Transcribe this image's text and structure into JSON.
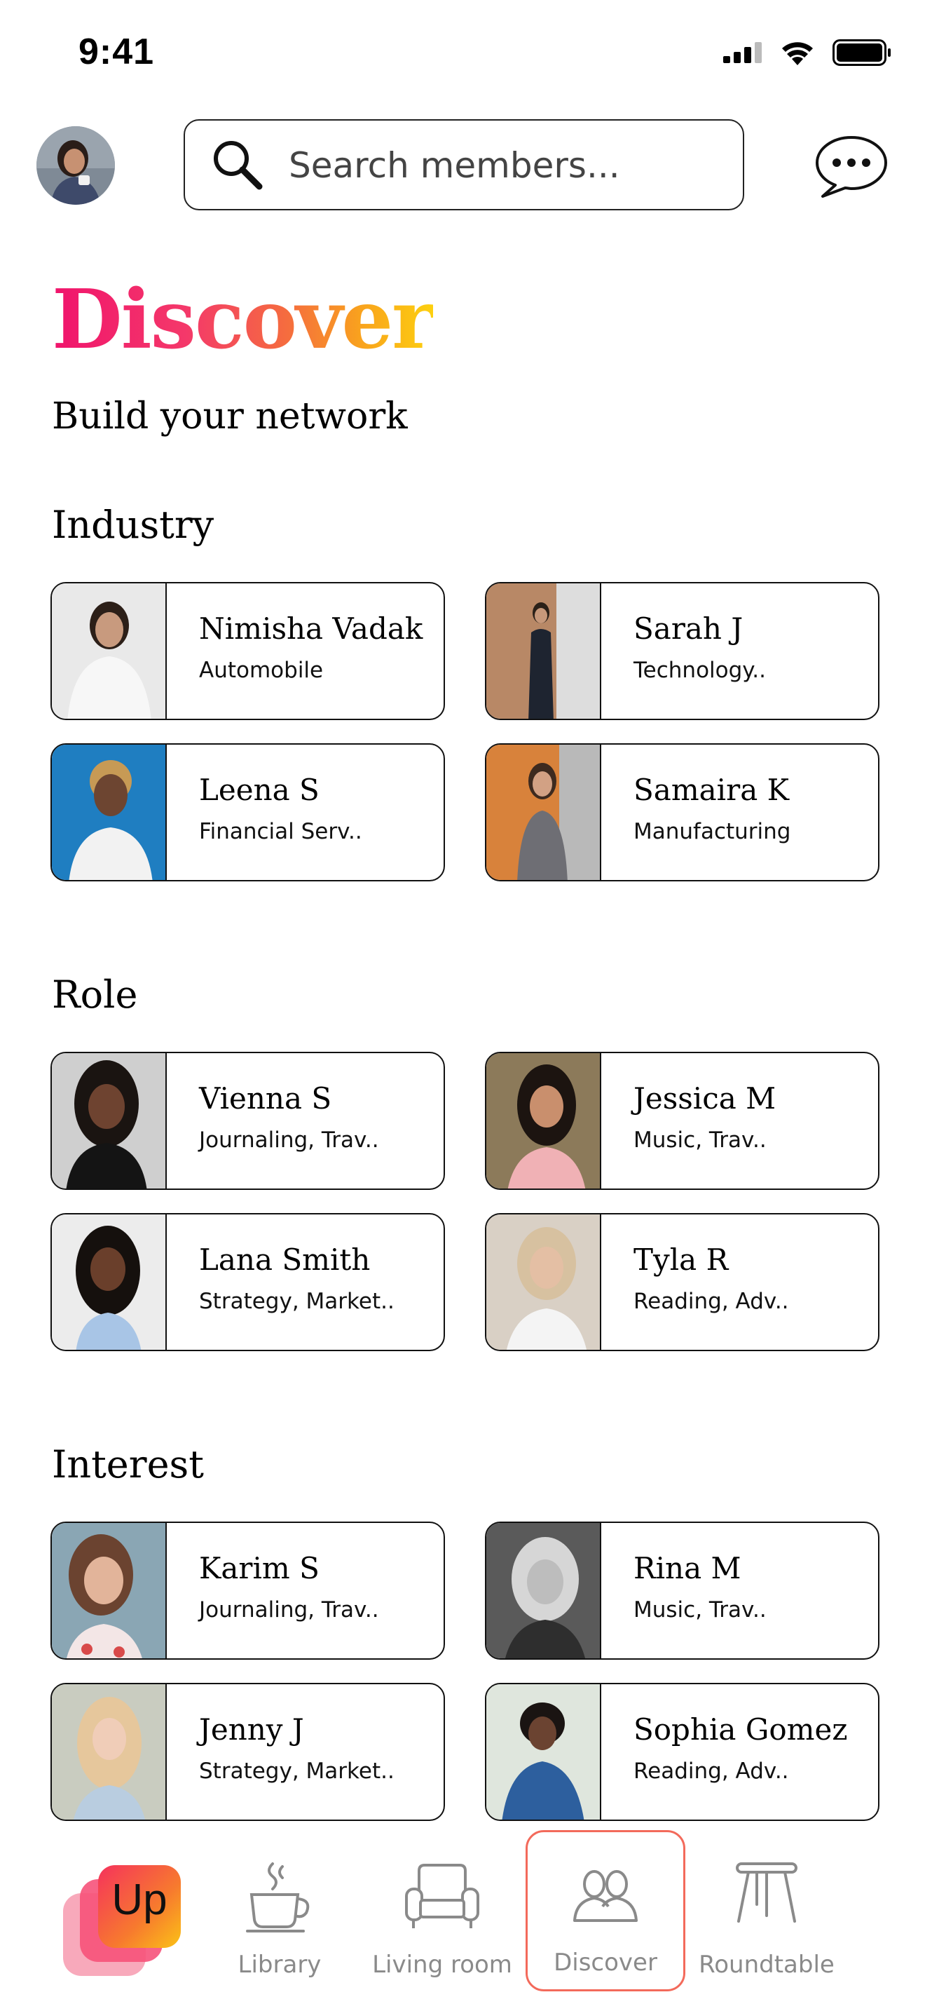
{
  "status_bar": {
    "time": "9:41"
  },
  "search": {
    "placeholder": "Search members..."
  },
  "page": {
    "title": "Discover",
    "subtitle": "Build your network"
  },
  "sections": [
    {
      "title": "Industry",
      "members": [
        {
          "name": "Nimisha Vadak",
          "tag": "Automobile"
        },
        {
          "name": "Sarah J",
          "tag": " Technology.."
        },
        {
          "name": "Leena S",
          "tag": "Financial Serv.."
        },
        {
          "name": "Samaira K",
          "tag": "Manufacturing"
        }
      ]
    },
    {
      "title": "Role",
      "members": [
        {
          "name": "Vienna S",
          "tag": "Journaling, Trav.."
        },
        {
          "name": "Jessica M",
          "tag": "Music, Trav.."
        },
        {
          "name": "Lana Smith",
          "tag": "Strategy, Market.."
        },
        {
          "name": "Tyla R",
          "tag": "Reading, Adv.."
        }
      ]
    },
    {
      "title": "Interest",
      "members": [
        {
          "name": "Karim S",
          "tag": "Journaling, Trav.."
        },
        {
          "name": "Rina M",
          "tag": "Music, Trav.."
        },
        {
          "name": "Jenny J",
          "tag": "Strategy, Market.."
        },
        {
          "name": "Sophia Gomez",
          "tag": "Reading, Adv.."
        }
      ]
    }
  ],
  "nav": {
    "logo_text": "Up",
    "items": [
      {
        "label": "Library",
        "icon": "coffee-cup-icon"
      },
      {
        "label": "Living room",
        "icon": "armchair-icon"
      },
      {
        "label": "Discover",
        "icon": "people-icon",
        "active": true
      },
      {
        "label": "Roundtable",
        "icon": "stool-icon"
      }
    ]
  },
  "colors": {
    "accent": "#f36a5b",
    "title_gradient": [
      "#f0146c",
      "#f56d3e",
      "#fdd00f"
    ]
  }
}
